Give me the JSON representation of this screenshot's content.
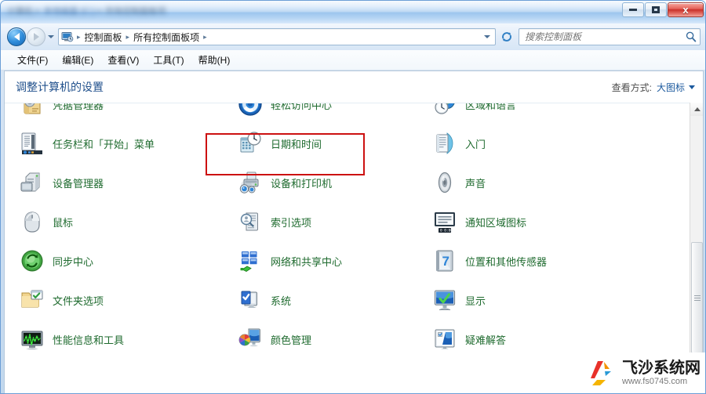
{
  "window": {
    "title_blurred_segments": [
      "计算机",
      "本地磁盘 (C:)",
      "所有控制面板项"
    ],
    "controls": {
      "minimize_label": "",
      "maximize_label": "",
      "close_label": "x"
    }
  },
  "navbar": {
    "back_tooltip": "后退",
    "forward_tooltip": "前进",
    "recent_tooltip": "最近浏览的页面",
    "breadcrumbs": [
      "控制面板",
      "所有控制面板项"
    ],
    "breadcrumb_separator": "▸",
    "refresh_label": "刷新",
    "search": {
      "placeholder": "搜索控制面板",
      "value": ""
    }
  },
  "menubar": {
    "items": [
      {
        "label": "文件(F)",
        "name": "menu-file"
      },
      {
        "label": "编辑(E)",
        "name": "menu-edit"
      },
      {
        "label": "查看(V)",
        "name": "menu-view"
      },
      {
        "label": "工具(T)",
        "name": "menu-tools"
      },
      {
        "label": "帮助(H)",
        "name": "menu-help"
      }
    ]
  },
  "content": {
    "page_title": "调整计算机的设置",
    "view_by": {
      "label": "查看方式:",
      "value": "大图标"
    }
  },
  "items": {
    "rows": [
      [
        {
          "label": "凭据管理器",
          "icon": "credential-manager-icon",
          "name": "item-credential-manager"
        },
        {
          "label": "轻松访问中心",
          "icon": "ease-of-access-icon",
          "name": "item-ease-of-access-center"
        },
        {
          "label": "区域和语言",
          "icon": "region-language-icon",
          "name": "item-region-and-language"
        }
      ],
      [
        {
          "label": "任务栏和「开始」菜单",
          "icon": "taskbar-start-menu-icon",
          "name": "item-taskbar-and-start-menu"
        },
        {
          "label": "日期和时间",
          "icon": "date-time-icon",
          "name": "item-date-and-time"
        },
        {
          "label": "入门",
          "icon": "getting-started-icon",
          "name": "item-getting-started"
        }
      ],
      [
        {
          "label": "设备管理器",
          "icon": "device-manager-icon",
          "name": "item-device-manager"
        },
        {
          "label": "设备和打印机",
          "icon": "devices-printers-icon",
          "name": "item-devices-and-printers"
        },
        {
          "label": "声音",
          "icon": "sound-icon",
          "name": "item-sound"
        }
      ],
      [
        {
          "label": "鼠标",
          "icon": "mouse-icon",
          "name": "item-mouse"
        },
        {
          "label": "索引选项",
          "icon": "indexing-options-icon",
          "name": "item-indexing-options"
        },
        {
          "label": "通知区域图标",
          "icon": "notification-area-icons-icon",
          "name": "item-notification-area-icons"
        }
      ],
      [
        {
          "label": "同步中心",
          "icon": "sync-center-icon",
          "name": "item-sync-center"
        },
        {
          "label": "网络和共享中心",
          "icon": "network-sharing-center-icon",
          "name": "item-network-and-sharing-center",
          "highlighted": true
        },
        {
          "label": "位置和其他传感器",
          "icon": "location-sensors-icon",
          "name": "item-location-and-other-sensors"
        }
      ],
      [
        {
          "label": "文件夹选项",
          "icon": "folder-options-icon",
          "name": "item-folder-options"
        },
        {
          "label": "系统",
          "icon": "system-icon",
          "name": "item-system"
        },
        {
          "label": "显示",
          "icon": "display-icon",
          "name": "item-display"
        }
      ],
      [
        {
          "label": "性能信息和工具",
          "icon": "performance-tools-icon",
          "name": "item-performance-information-and-tools"
        },
        {
          "label": "颜色管理",
          "icon": "color-management-icon",
          "name": "item-color-management"
        },
        {
          "label": "疑难解答",
          "icon": "troubleshooting-icon",
          "name": "item-troubleshooting"
        }
      ]
    ]
  },
  "watermark": {
    "title": "飞沙系统网",
    "url": "www.fs0745.com"
  },
  "colors": {
    "highlight_red": "#cc1111",
    "item_label_green": "#1f6b2f",
    "page_title_blue": "#20508c",
    "close_button_red": "#c9302a"
  }
}
